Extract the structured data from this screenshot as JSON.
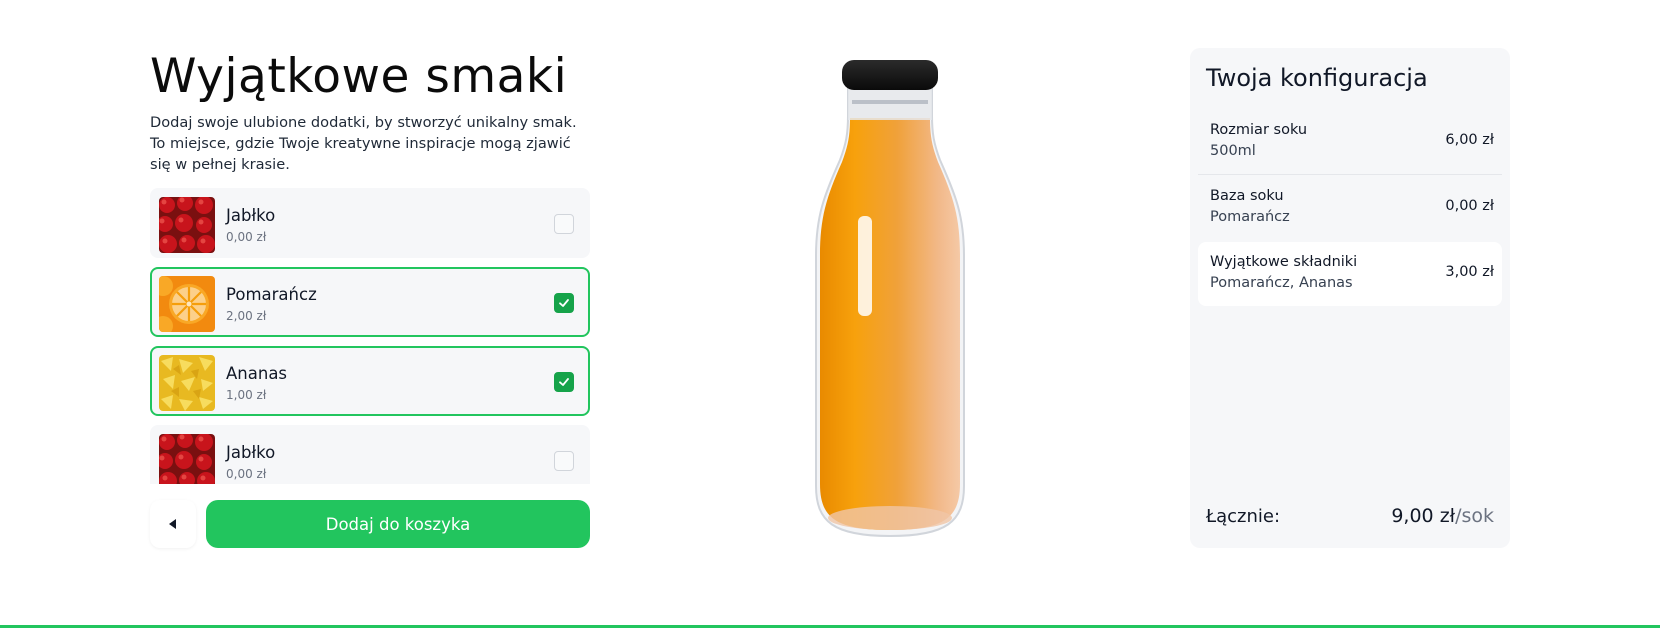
{
  "heading": {
    "title": "Wyjątkowe smaki",
    "description": "Dodaj swoje ulubione dodatki, by stworzyć unikalny smak. To miejsce, gdzie Twoje kreatywne inspiracje mogą zjawić się w pełnej krasie."
  },
  "ingredients": [
    {
      "name": "Jabłko",
      "price": "0,00 zł",
      "selected": false,
      "image": "apple"
    },
    {
      "name": "Pomarańcz",
      "price": "2,00 zł",
      "selected": true,
      "image": "orange"
    },
    {
      "name": "Ananas",
      "price": "1,00 zł",
      "selected": true,
      "image": "pineapple"
    },
    {
      "name": "Jabłko",
      "price": "0,00 zł",
      "selected": false,
      "image": "apple"
    }
  ],
  "actions": {
    "back_icon": "caret-left-icon",
    "add_to_cart_label": "Dodaj do koszyka"
  },
  "product_image": "juice-bottle",
  "summary": {
    "title": "Twoja konfiguracja",
    "rows": [
      {
        "label": "Rozmiar soku",
        "value": "500ml",
        "price": "6,00 zł"
      },
      {
        "label": "Baza soku",
        "value": "Pomarańcz",
        "price": "0,00 zł"
      },
      {
        "label": "Wyjątkowe składniki",
        "value": "Pomarańcz, Ananas",
        "price": "3,00 zł"
      }
    ],
    "total_label": "Łącznie:",
    "total_price": "9,00 zł",
    "total_unit": "/sok"
  },
  "colors": {
    "accent": "#22c55e",
    "check": "#16a34a",
    "panel": "#f6f7f9"
  }
}
